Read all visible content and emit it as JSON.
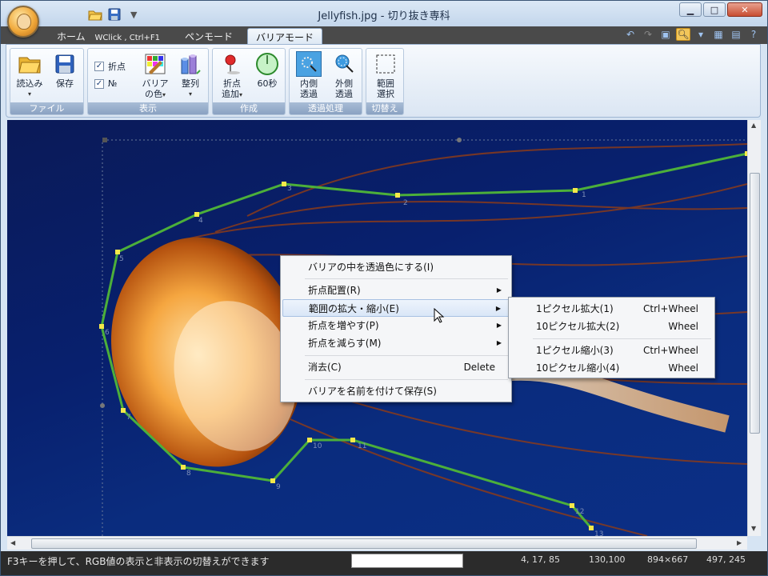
{
  "window": {
    "title": "Jellyfish.jpg - 切り抜き専科",
    "controls": {
      "minimize": "▁",
      "maximize": "□",
      "close": "✕"
    }
  },
  "quick_access": {
    "open_icon": "folder-open-icon",
    "save_icon": "floppy-icon",
    "customize": "▼"
  },
  "tabs": [
    {
      "label": "ホーム",
      "shortcut": "WClick , Ctrl+F1",
      "active": false
    },
    {
      "label": "ペンモード",
      "active": false
    },
    {
      "label": "バリアモード",
      "active": true
    }
  ],
  "ribbon": {
    "groups": [
      {
        "label": "ファイル",
        "buttons": [
          "読込み",
          "保存"
        ]
      },
      {
        "label": "表示",
        "checks": [
          "折点",
          "№"
        ],
        "buttons": [
          "バリア\nの色",
          "整列"
        ]
      },
      {
        "label": "作成",
        "buttons": [
          "折点\n追加",
          "60秒"
        ]
      },
      {
        "label": "透過処理",
        "buttons": [
          "内側\n透過",
          "外側\n透過"
        ]
      },
      {
        "label": "切替え",
        "buttons": [
          "範囲\n選択"
        ]
      }
    ],
    "file_open": "読込み",
    "file_save": "保存",
    "view_check_points": "折点",
    "view_check_number": "№",
    "view_barrier_color_line1": "バリア",
    "view_barrier_color_line2": "の色",
    "view_align": "整列",
    "create_add_line1": "折点",
    "create_add_line2": "追加",
    "create_60s": "60秒",
    "trans_inner_line1": "内側",
    "trans_inner_line2": "透過",
    "trans_outer_line1": "外側",
    "trans_outer_line2": "透過",
    "switch_line1": "範囲",
    "switch_line2": "選択",
    "group_file": "ファイル",
    "group_view": "表示",
    "group_create": "作成",
    "group_trans": "透過処理",
    "group_switch": "切替え"
  },
  "canvas": {
    "point_labels": [
      "1",
      "2",
      "3",
      "4",
      "5",
      "6",
      "7",
      "8",
      "9",
      "10",
      "11",
      "12",
      "13"
    ],
    "barrier_color": "#4caf3a",
    "point_color": "#f5e84a"
  },
  "context_menu": {
    "items": [
      {
        "label": "バリアの中を透過色にする(I)"
      },
      {
        "label": "折点配置(R)",
        "submenu": true
      },
      {
        "label": "範囲の拡大・縮小(E)",
        "submenu": true,
        "highlighted": true
      },
      {
        "label": "折点を増やす(P)",
        "submenu": true
      },
      {
        "label": "折点を減らす(M)",
        "submenu": true
      },
      {
        "label": "消去(C)",
        "shortcut": "Delete"
      },
      {
        "label": "バリアを名前を付けて保存(S)"
      }
    ]
  },
  "submenu": {
    "items": [
      {
        "label": "1ピクセル拡大(1)",
        "shortcut": "Ctrl+Wheel"
      },
      {
        "label": "10ピクセル拡大(2)",
        "shortcut": "Wheel"
      },
      {
        "label": "1ピクセル縮小(3)",
        "shortcut": "Ctrl+Wheel"
      },
      {
        "label": "10ピクセル縮小(4)",
        "shortcut": "Wheel"
      }
    ]
  },
  "status": {
    "message": "F3キーを押して、RGB値の表示と非表示の切替えができます",
    "rgb": "4, 17, 85",
    "zoom": "130,100",
    "size": "894×667",
    "cursor": "497, 245"
  }
}
